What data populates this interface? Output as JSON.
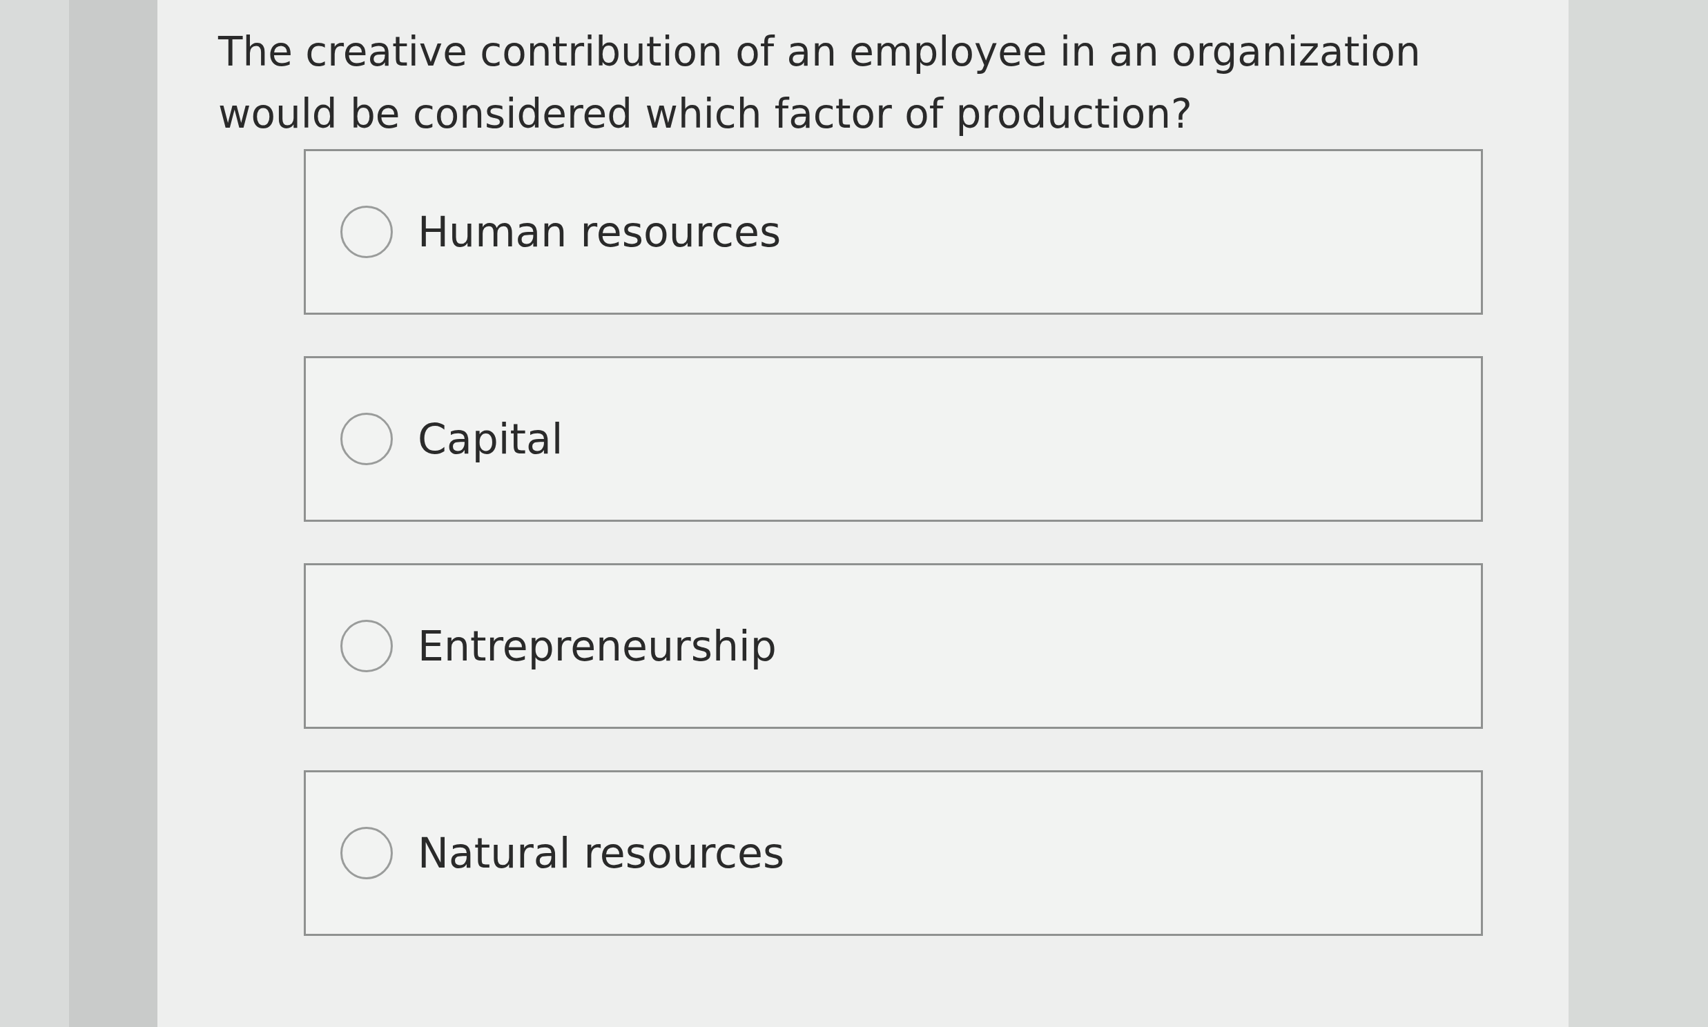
{
  "question": "The creative contribution of an employee in an organization would be considered which factor of production?",
  "options": [
    {
      "label": "Human resources",
      "selected": false
    },
    {
      "label": "Capital",
      "selected": false
    },
    {
      "label": "Entrepreneurship",
      "selected": false
    },
    {
      "label": "Natural resources",
      "selected": false
    }
  ]
}
